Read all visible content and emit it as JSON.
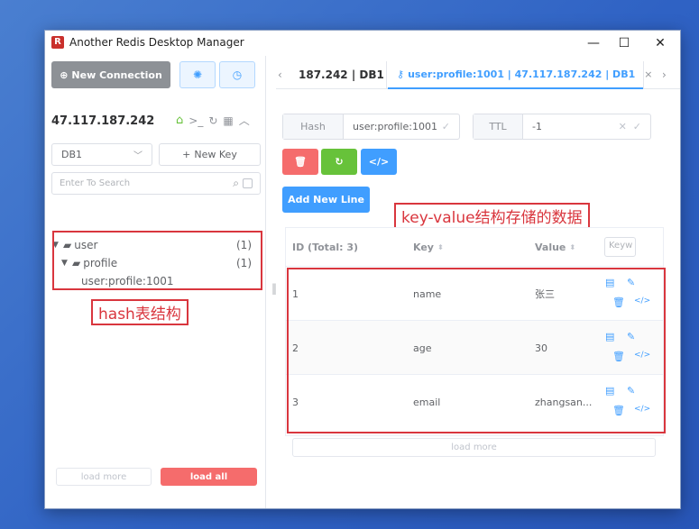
{
  "window": {
    "title": "Another Redis Desktop Manager",
    "minimize": "—",
    "maximize": "☐",
    "close": "✕"
  },
  "sidebar": {
    "new_connection_label": "New Connection",
    "connection_host": "47.117.187.242",
    "db_select_value": "DB1",
    "new_key_label": "New Key",
    "search_placeholder": "Enter To Search",
    "tree": [
      {
        "label": "user",
        "count": "(1)"
      },
      {
        "label": "profile",
        "count": "(1)"
      },
      {
        "label": "user:profile:1001"
      }
    ],
    "load_more_label": "load more",
    "load_all_label": "load all"
  },
  "tabs": [
    {
      "label": "187.242 | DB1"
    },
    {
      "label": "user:profile:1001 | 47.117.187.242 | DB1",
      "active": true
    }
  ],
  "key_info": {
    "type_label": "Hash",
    "key_name": "user:profile:1001",
    "ttl_label": "TTL",
    "ttl_value": "-1"
  },
  "actions": {
    "add_new_line_label": "Add New Line"
  },
  "table": {
    "headers": {
      "id": "ID (Total: 3)",
      "key": "Key",
      "value": "Value",
      "keyword_placeholder": "Keyw"
    },
    "rows": [
      {
        "id": "1",
        "key": "name",
        "value": "张三"
      },
      {
        "id": "2",
        "key": "age",
        "value": "30"
      },
      {
        "id": "3",
        "key": "email",
        "value": "zhangsan..."
      }
    ],
    "load_more_label": "load more"
  },
  "annotations": {
    "hash_structure": "hash表结构",
    "kv_data": "key-value结构存储的数据"
  },
  "colors": {
    "primary": "#409eff",
    "danger": "#f56c6c",
    "success": "#67c23a",
    "annotation": "#d9363e",
    "desktop": "#2f62c4"
  }
}
